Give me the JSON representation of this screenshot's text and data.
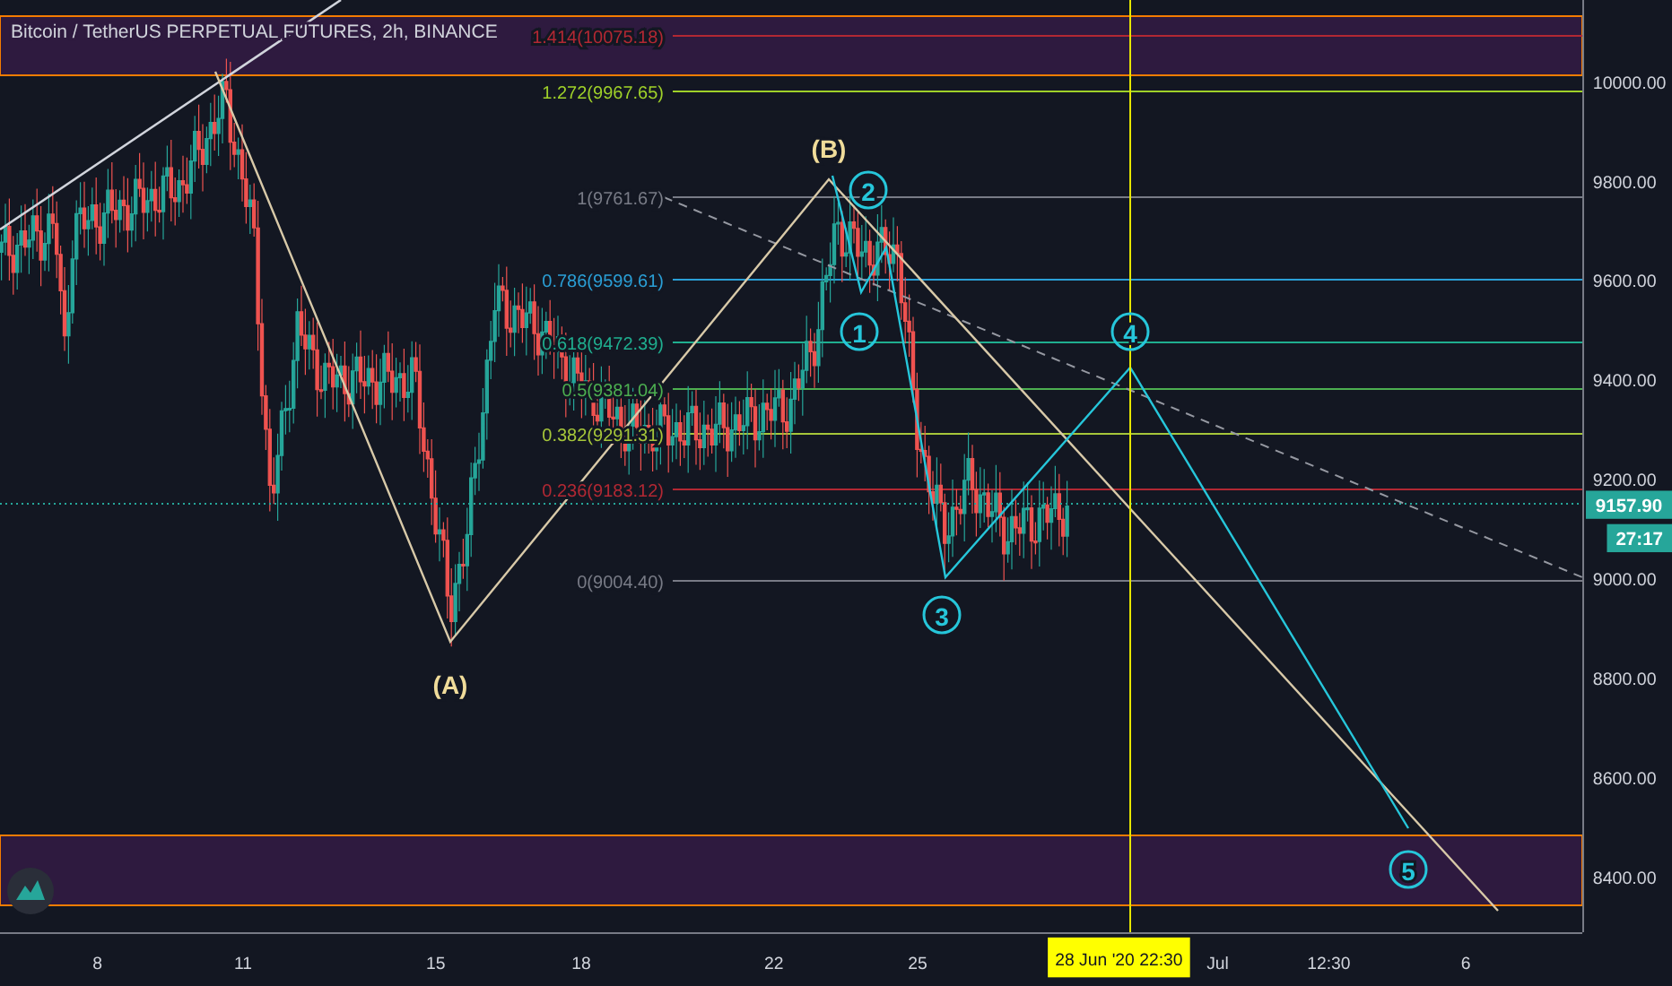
{
  "title": "Bitcoin / TetherUS PERPETUAL FUTURES, 2h, BINANCE",
  "fib_levels": [
    {
      "label": "1.414(10075.18)",
      "color": "#b22833"
    },
    {
      "label": "1.272(9967.65)",
      "color": "#9fd129"
    },
    {
      "label": "1(9761.67)",
      "color": "#787b86"
    },
    {
      "label": "0.786(9599.61)",
      "color": "#2a9fd6"
    },
    {
      "label": "0.618(9472.39)",
      "color": "#1fae8f"
    },
    {
      "label": "0.5(9381.04)",
      "color": "#4caf50"
    },
    {
      "label": "0.382(9291.31)",
      "color": "#a6c63a"
    },
    {
      "label": "0.236(9183.12)",
      "color": "#b22833"
    },
    {
      "label": "0(9004.40)",
      "color": "#787b86"
    }
  ],
  "wave_labels": [
    {
      "kind": "corrective",
      "label": "(A)"
    },
    {
      "kind": "corrective",
      "label": "(B)"
    },
    {
      "kind": "impulse",
      "label": "1"
    },
    {
      "kind": "impulse",
      "label": "2"
    },
    {
      "kind": "impulse",
      "label": "3"
    },
    {
      "kind": "impulse",
      "label": "4"
    },
    {
      "kind": "impulse",
      "label": "5"
    }
  ],
  "price_axis": {
    "ticks": [
      "10000.00",
      "9800.00",
      "9600.00",
      "9400.00",
      "9200.00",
      "9000.00",
      "8800.00",
      "8600.00",
      "8400.00"
    ],
    "last_price": "9157.90",
    "countdown": "27:17"
  },
  "time_axis": {
    "ticks": [
      "8",
      "11",
      "15",
      "18",
      "22",
      "25",
      "Jul",
      "12:30",
      "6"
    ],
    "crosshair_label": "28 Jun '20  22:30"
  }
}
